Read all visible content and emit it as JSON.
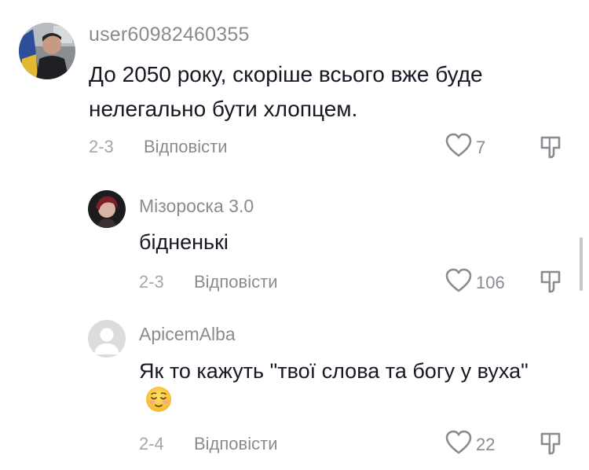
{
  "comments": [
    {
      "username": "user60982460355",
      "text": "До 2050 року, скоріше всього вже буде нелегально бути хлопцем.",
      "date": "2-3",
      "reply_label": "Відповісти",
      "likes": "7",
      "avatar": "user-photo"
    },
    {
      "username": "Мізороска 3.0",
      "text": "бідненькі",
      "date": "2-3",
      "reply_label": "Відповісти",
      "likes": "106",
      "avatar": "user-photo"
    },
    {
      "username": "ApicemAlba",
      "text": "Як то кажуть \"твої слова та богу у вуха\"",
      "emoji": "relieved-face-emoji",
      "date": "2-4",
      "reply_label": "Відповісти",
      "likes": "22",
      "avatar": "default-placeholder"
    }
  ],
  "colors": {
    "text": "#161823",
    "secondary": "#8a8b91",
    "date": "#a6a7ab",
    "background": "#ffffff"
  },
  "icons": [
    "heart-icon",
    "dislike-icon"
  ]
}
